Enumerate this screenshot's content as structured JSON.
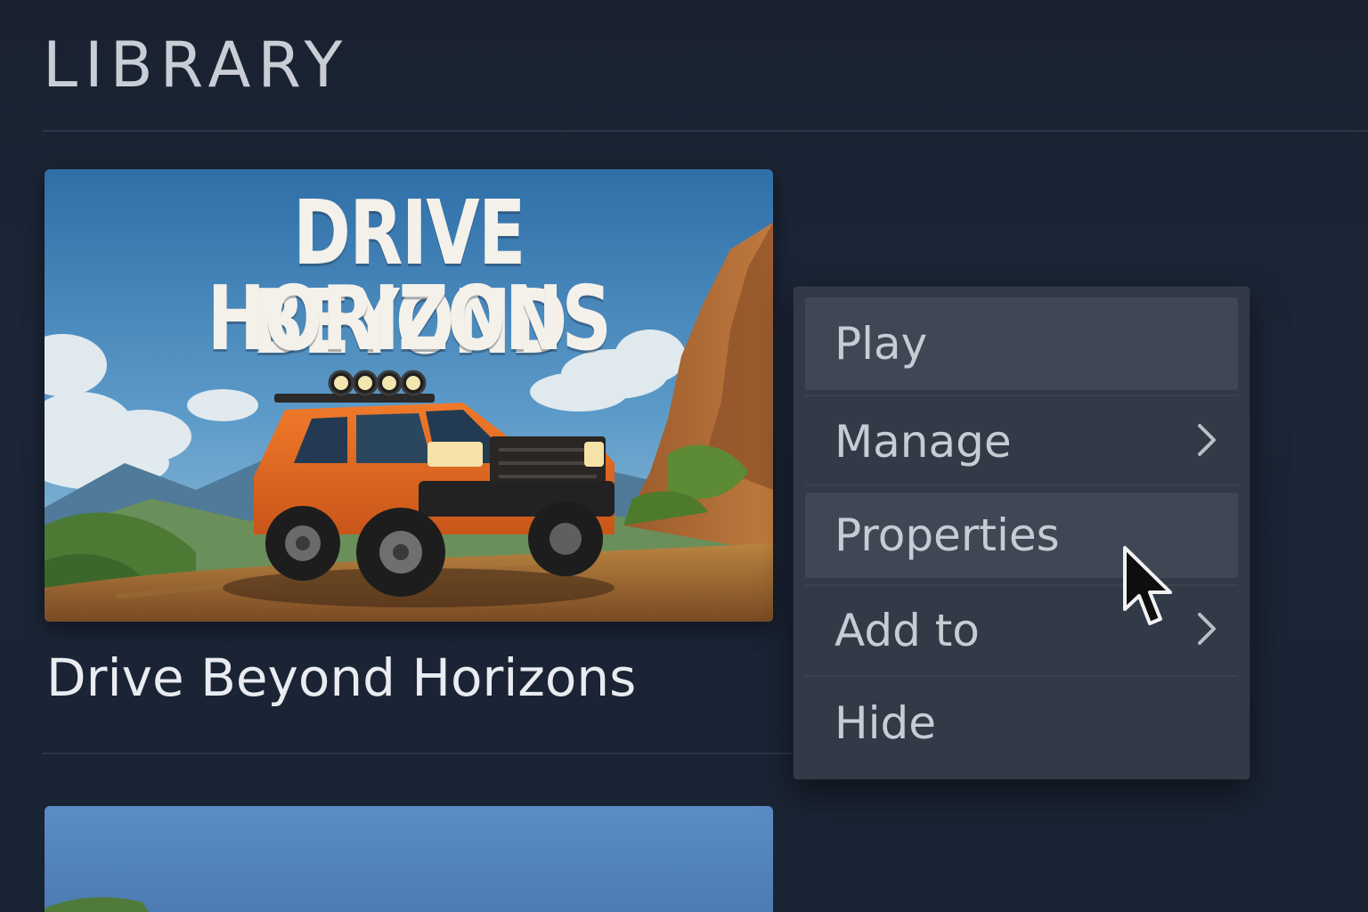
{
  "header": {
    "title": "LIBRARY"
  },
  "games": [
    {
      "cover_title_line1": "DRIVE BEYOND",
      "cover_title_line2": "HORIZONS",
      "name": "Drive Beyond Horizons"
    }
  ],
  "context_menu": {
    "items": [
      {
        "label": "Play",
        "has_submenu": false
      },
      {
        "label": "Manage",
        "has_submenu": true
      },
      {
        "label": "Properties",
        "has_submenu": false
      },
      {
        "label": "Add to",
        "has_submenu": true
      },
      {
        "label": "Hide",
        "has_submenu": false
      }
    ],
    "hovered_item": "Properties"
  },
  "colors": {
    "background": "#1b2434",
    "menu_background": "#323a47",
    "menu_highlight": "#3f4755",
    "text_primary": "#e9ecf0",
    "menu_text": "#c7ccd4"
  },
  "icons": {
    "submenu": "chevron-right-icon",
    "pointer": "mouse-cursor-icon"
  }
}
